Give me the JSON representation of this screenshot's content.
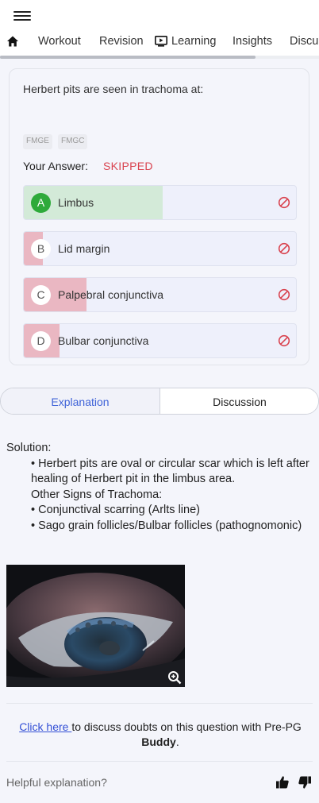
{
  "nav": {
    "tabs": [
      "Workout",
      "Revision",
      "Learning",
      "Insights",
      "Discu"
    ]
  },
  "question": {
    "text": "Herbert pits are seen in trachoma at:",
    "tags": [
      "FMGE",
      "FMGC"
    ],
    "answer_label": "Your Answer:",
    "answer_value": "SKIPPED",
    "options": [
      {
        "letter": "A",
        "text": "Limbus",
        "correct": true,
        "percent": 51
      },
      {
        "letter": "B",
        "text": "Lid margin",
        "correct": false,
        "percent": 7
      },
      {
        "letter": "C",
        "text": "Palpebral conjunctiva",
        "correct": false,
        "percent": 23
      },
      {
        "letter": "D",
        "text": "Bulbar conjunctiva",
        "correct": false,
        "percent": 13
      }
    ]
  },
  "toggle": {
    "explanation": "Explanation",
    "discussion": "Discussion"
  },
  "solution": {
    "heading": "Solution:",
    "lines": [
      "• Herbert pits are oval or circular scar which is left after healing of Herbert pit in the limbus area.",
      "Other Signs of Trachoma:",
      "• Conjunctival scarring (Arlts line)",
      "• Sago grain follicles/Bulbar follicles (pathognomonic)"
    ]
  },
  "discuss": {
    "link": "Click here ",
    "text_before_bold": "to discuss doubts on this question with Pre-PG ",
    "bold": "Buddy",
    "text_after": "."
  },
  "feedback": {
    "label": "Helpful explanation?"
  },
  "colors": {
    "correct": "#2eaa3a",
    "correct_fill": "#d3ead8",
    "wrong_fill": "#eab7c2",
    "skipped": "#d9434f",
    "link": "#3450d6"
  }
}
